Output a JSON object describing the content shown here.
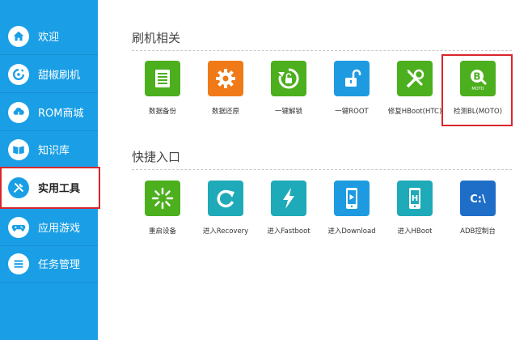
{
  "sidebar": {
    "items": [
      {
        "label": "欢迎",
        "icon": "home-icon"
      },
      {
        "label": "甜椒刷机",
        "icon": "refresh-icon"
      },
      {
        "label": "ROM商城",
        "icon": "cloud-download-icon"
      },
      {
        "label": "知识库",
        "icon": "book-icon"
      },
      {
        "label": "实用工具",
        "icon": "tools-icon"
      },
      {
        "label": "应用游戏",
        "icon": "gamepad-icon"
      },
      {
        "label": "任务管理",
        "icon": "list-icon"
      }
    ],
    "active_index": 4
  },
  "sections": [
    {
      "title": "刷机相关",
      "tools": [
        {
          "label": "数据备份",
          "icon": "document-icon",
          "color": "#4caf1e"
        },
        {
          "label": "数据还原",
          "icon": "gear-icon",
          "color": "#f07a18"
        },
        {
          "label": "一键解锁",
          "icon": "unlock-circle-icon",
          "color": "#4caf1e"
        },
        {
          "label": "一键ROOT",
          "icon": "padlock-icon",
          "color": "#1e9be0"
        },
        {
          "label": "修复HBoot(HTC)",
          "icon": "wrench-screwdriver-icon",
          "color": "#4caf1e"
        },
        {
          "label": "检测BL(MOTO)",
          "icon": "moto-bl-icon",
          "color": "#4caf1e",
          "badge": "MOTO"
        }
      ]
    },
    {
      "title": "快捷入口",
      "tools": [
        {
          "label": "重启设备",
          "icon": "restart-icon",
          "color": "#4caf1e"
        },
        {
          "label": "进入Recovery",
          "icon": "recovery-icon",
          "color": "#1eaab8"
        },
        {
          "label": "进入Fastboot",
          "icon": "lightning-icon",
          "color": "#1eaab8"
        },
        {
          "label": "进入Download",
          "icon": "phone-download-icon",
          "color": "#1e9be0"
        },
        {
          "label": "进入HBoot",
          "icon": "phone-h-icon",
          "color": "#1eaab8"
        },
        {
          "label": "ADB控制台",
          "icon": "console-icon",
          "color": "#1e6ec8",
          "text": "C:\\"
        }
      ]
    }
  ],
  "colors": {
    "sidebar": "#1a9fe6",
    "highlight": "#d9262c",
    "green": "#4caf1e",
    "orange": "#f07a18",
    "teal": "#1eaab8",
    "blue": "#1e9be0"
  }
}
